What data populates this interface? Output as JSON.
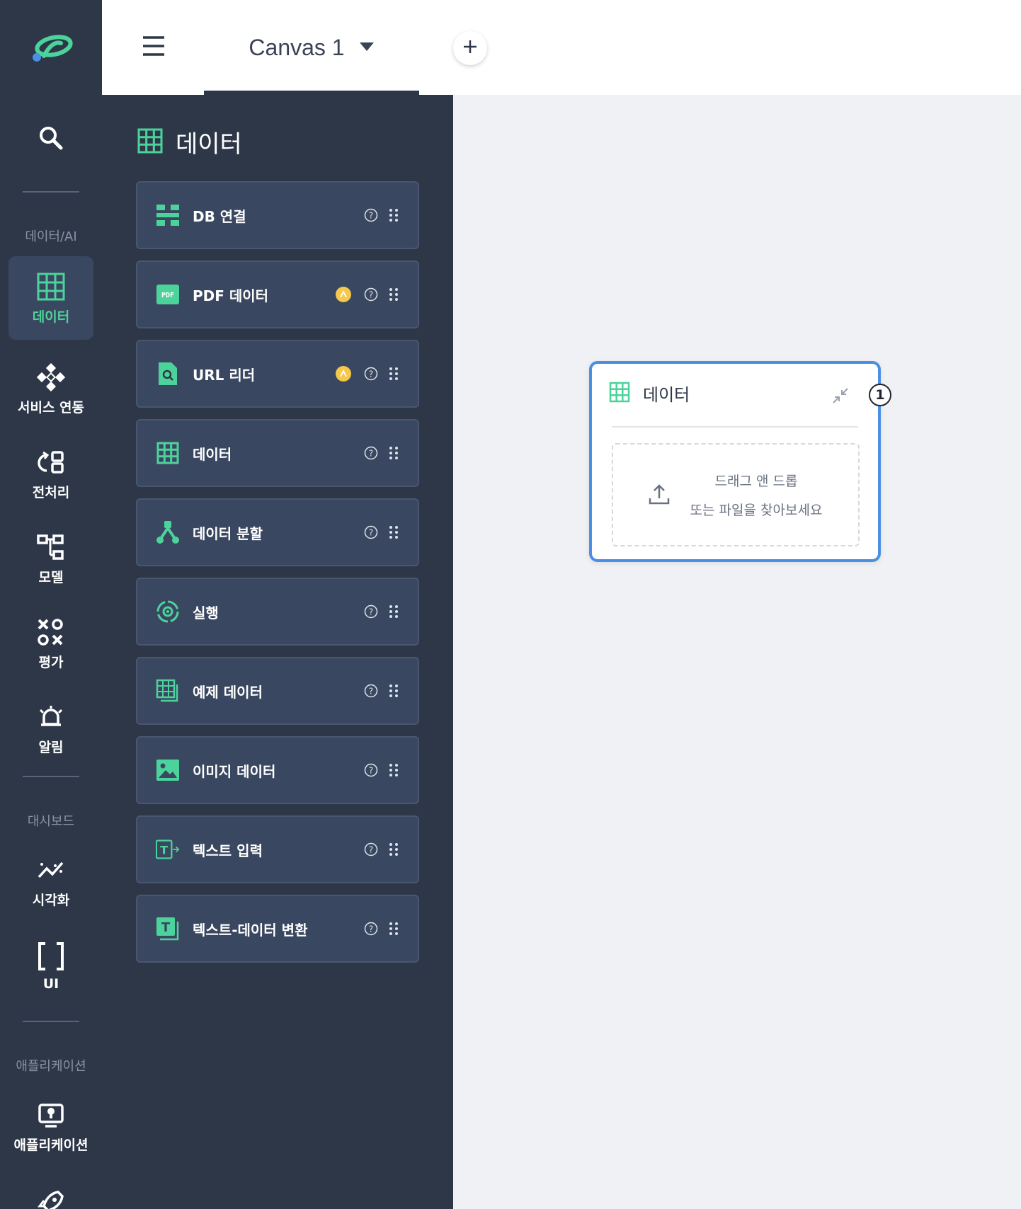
{
  "rail": {
    "logo": "logo-icon",
    "search_icon": "search-icon",
    "sections": {
      "data_ai": "데이터/AI",
      "dashboard": "대시보드",
      "application": "애플리케이션"
    },
    "items": [
      {
        "label": "데이터",
        "icon": "grid-icon",
        "active": true
      },
      {
        "label": "서비스 연동",
        "icon": "service-icon"
      },
      {
        "label": "전처리",
        "icon": "preprocess-icon"
      },
      {
        "label": "모델",
        "icon": "model-icon"
      },
      {
        "label": "평가",
        "icon": "evaluation-icon"
      },
      {
        "label": "알림",
        "icon": "bell-icon"
      },
      {
        "label": "시각화",
        "icon": "chart-icon"
      },
      {
        "label": "UI",
        "icon": "brackets-icon"
      },
      {
        "label": "애플리케이션",
        "icon": "app-icon"
      },
      {
        "label": "",
        "icon": "rocket-icon"
      }
    ]
  },
  "topbar": {
    "menu_icon": "hamburger-icon",
    "canvas_tab": "Canvas 1",
    "add_tab_icon": "plus-icon"
  },
  "panel": {
    "title": "데이터",
    "nodes": [
      {
        "label": "DB 연결",
        "icon": "db-icon",
        "premium": false
      },
      {
        "label": "PDF 데이터",
        "icon": "pdf-icon",
        "premium": true
      },
      {
        "label": "URL 리더",
        "icon": "url-reader-icon",
        "premium": true
      },
      {
        "label": "데이터",
        "icon": "grid-icon",
        "premium": false
      },
      {
        "label": "데이터 분할",
        "icon": "split-icon",
        "premium": false
      },
      {
        "label": "실행",
        "icon": "run-icon",
        "premium": false
      },
      {
        "label": "예제 데이터",
        "icon": "sample-data-icon",
        "premium": false
      },
      {
        "label": "이미지 데이터",
        "icon": "image-icon",
        "premium": false
      },
      {
        "label": "텍스트 입력",
        "icon": "text-input-icon",
        "premium": false
      },
      {
        "label": "텍스트-데이터 변환",
        "icon": "text-convert-icon",
        "premium": false
      }
    ]
  },
  "canvas_node": {
    "title": "데이터",
    "badge": "1",
    "drop_line1": "드래그 앤 드롭",
    "drop_line2": "또는 파일을 찾아보세요"
  },
  "colors": {
    "accent": "#4cd39b",
    "rail_bg": "#2d3748",
    "card_bg": "#3a4760",
    "node_border": "#4a90e2",
    "coin": "#f5c84c"
  }
}
